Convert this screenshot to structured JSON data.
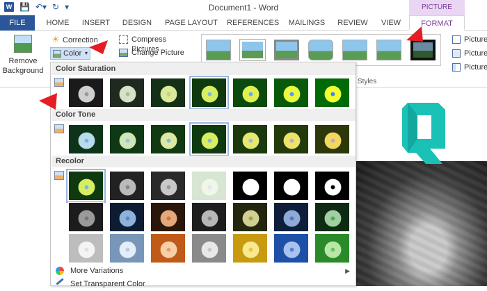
{
  "titlebar": {
    "title": "Document1 - Word",
    "picture_tools_label": "PICTURE TOOLS",
    "word_logo": "W"
  },
  "tabs": {
    "file": "FILE",
    "home": "HOME",
    "insert": "INSERT",
    "design": "DESIGN",
    "page_layout": "PAGE LAYOUT",
    "references": "REFERENCES",
    "mailings": "MAILINGS",
    "review": "REVIEW",
    "view": "VIEW",
    "format": "FORMAT"
  },
  "ribbon": {
    "remove_background_line1": "Remove",
    "remove_background_line2": "Background",
    "corrections": "Correction",
    "color": "Color",
    "compress_pictures": "Compress Pictures",
    "change_picture": "Change Picture",
    "picture_border": "Picture",
    "picture_effects": "Picture",
    "picture_layout": "Picture",
    "styles_group_label": "Styles"
  },
  "color_menu": {
    "saturation_header": "Color Saturation",
    "tone_header": "Color Tone",
    "recolor_header": "Recolor",
    "more_variations": "More Variations",
    "set_transparent": "Set Transparent Color",
    "saturation_swatches": [
      {
        "mode": "sat0"
      },
      {
        "mode": "sat33"
      },
      {
        "mode": "sat66"
      },
      {
        "mode": "sat100",
        "selected": true
      },
      {
        "mode": "sat133"
      },
      {
        "mode": "sat200"
      },
      {
        "mode": "sat300"
      }
    ],
    "tone_swatches": [
      {
        "mode": "t1"
      },
      {
        "mode": "t2"
      },
      {
        "mode": "t3"
      },
      {
        "mode": "t4",
        "selected": true
      },
      {
        "mode": "t5"
      },
      {
        "mode": "t6"
      },
      {
        "mode": "t7"
      }
    ],
    "recolor_rows": [
      [
        "r-none-sel",
        "r-gray",
        "r-gray2",
        "r-washout",
        "r-bw1",
        "r-bw2",
        "r-bw3"
      ],
      [
        "r-dark1",
        "r-darkblue",
        "r-darkorange",
        "r-darkgray",
        "r-darkolive",
        "r-darkblue2",
        "r-darkgreen"
      ],
      [
        "r-light1",
        "r-lightblue",
        "r-orange",
        "r-lightgray",
        "r-yellow",
        "r-blue",
        "r-green"
      ]
    ]
  },
  "colors": {
    "file_tab": "#2b579a",
    "picture_tools": "#7a3b97",
    "arrow_red": "#e31e24",
    "logo_teal": "#1ac1b6"
  }
}
